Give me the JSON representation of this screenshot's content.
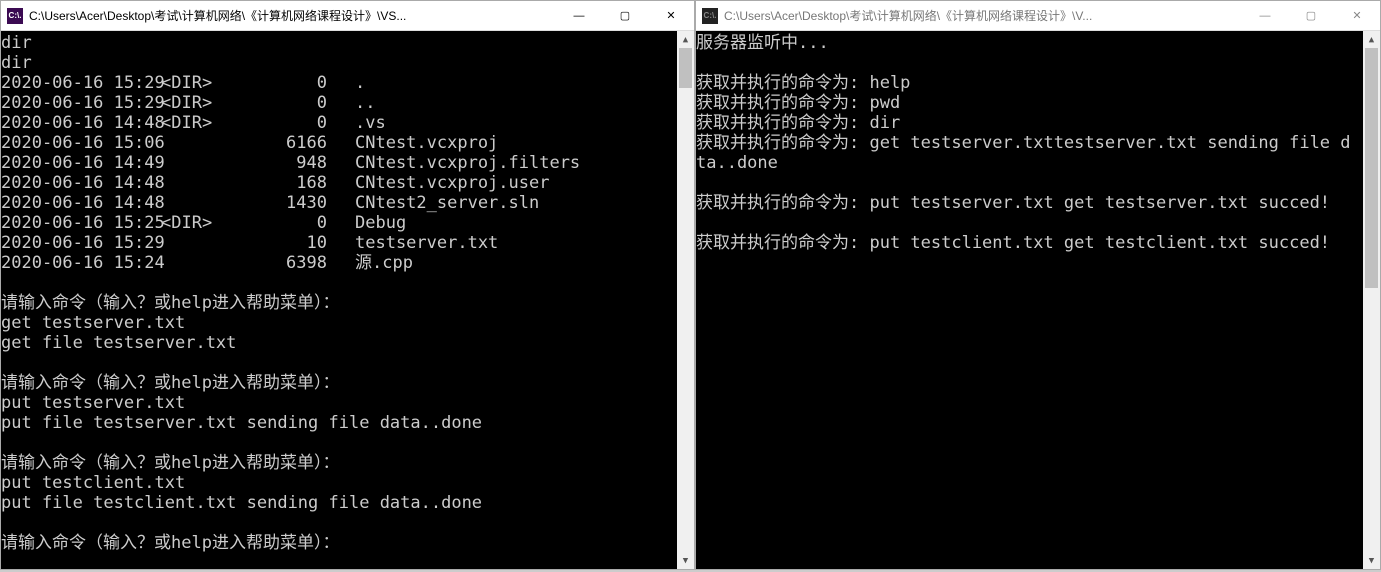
{
  "left": {
    "title": "C:\\Users\\Acer\\Desktop\\考试\\计算机网络\\《计算机网络课程设计》\\VS...",
    "app_icon_text": "C:\\.",
    "pre_lines": [
      "dir",
      "dir"
    ],
    "dir_rows": [
      {
        "date": "2020-06-16 15:29",
        "dir": "<DIR>",
        "size": "0",
        "name": "."
      },
      {
        "date": "2020-06-16 15:29",
        "dir": "<DIR>",
        "size": "0",
        "name": ".."
      },
      {
        "date": "2020-06-16 14:48",
        "dir": "<DIR>",
        "size": "0",
        "name": ".vs"
      },
      {
        "date": "2020-06-16 15:06",
        "dir": "",
        "size": "6166",
        "name": "CNtest.vcxproj"
      },
      {
        "date": "2020-06-16 14:49",
        "dir": "",
        "size": "948",
        "name": "CNtest.vcxproj.filters"
      },
      {
        "date": "2020-06-16 14:48",
        "dir": "",
        "size": "168",
        "name": "CNtest.vcxproj.user"
      },
      {
        "date": "2020-06-16 14:48",
        "dir": "",
        "size": "1430",
        "name": "CNtest2_server.sln"
      },
      {
        "date": "2020-06-16 15:25",
        "dir": "<DIR>",
        "size": "0",
        "name": "Debug"
      },
      {
        "date": "2020-06-16 15:29",
        "dir": "",
        "size": "10",
        "name": "testserver.txt"
      },
      {
        "date": "2020-06-16 15:24",
        "dir": "",
        "size": "6398",
        "name": "源.cpp"
      }
    ],
    "post_lines": [
      "",
      "请输入命令（输入？或help进入帮助菜单）：",
      "get testserver.txt",
      "get file testserver.txt",
      "",
      "请输入命令（输入？或help进入帮助菜单）：",
      "put testserver.txt",
      "put file testserver.txt sending file data..done",
      "",
      "请输入命令（输入？或help进入帮助菜单）：",
      "put testclient.txt",
      "put file testclient.txt sending file data..done",
      "",
      "请输入命令（输入？或help进入帮助菜单）："
    ]
  },
  "right": {
    "title": "C:\\Users\\Acer\\Desktop\\考试\\计算机网络\\《计算机网络课程设计》\\V...",
    "app_icon_text": "C:\\.",
    "lines": [
      "服务器监听中...",
      "",
      "获取并执行的命令为: help",
      "获取并执行的命令为: pwd",
      "获取并执行的命令为: dir",
      "获取并执行的命令为: get testserver.txttestserver.txt sending file d",
      "ta..done",
      "",
      "获取并执行的命令为: put testserver.txt get testserver.txt succed!",
      "",
      "获取并执行的命令为: put testclient.txt get testclient.txt succed!"
    ]
  },
  "controls": {
    "minimize": "—",
    "maximize": "▢",
    "close": "✕"
  }
}
